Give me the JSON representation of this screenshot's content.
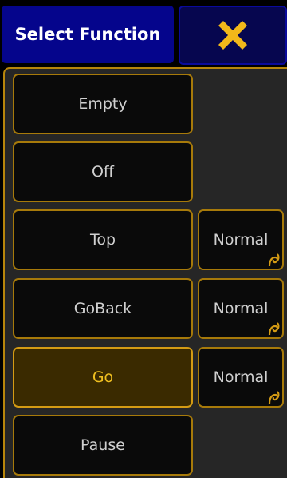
{
  "header": {
    "title": "Select Function",
    "close_icon": "close-x-icon"
  },
  "colors": {
    "title_bg": "#05058c",
    "accent": "#d49b14",
    "active_bg": "#3a2a00",
    "active_text": "#f0c020"
  },
  "functions": [
    {
      "label": "Empty",
      "active": false
    },
    {
      "label": "Off",
      "active": false
    },
    {
      "label": "Top",
      "active": false,
      "mode": "Normal"
    },
    {
      "label": "GoBack",
      "active": false,
      "mode": "Normal"
    },
    {
      "label": "Go",
      "active": true,
      "mode": "Normal"
    },
    {
      "label": "Pause",
      "active": false
    }
  ]
}
